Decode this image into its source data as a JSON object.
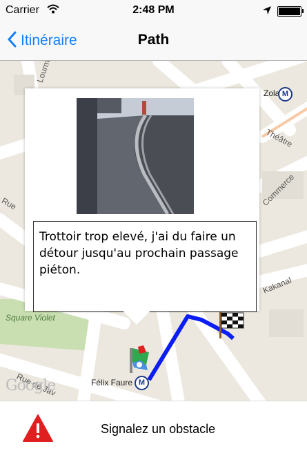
{
  "status": {
    "carrier": "Carrier",
    "time": "2:48 PM"
  },
  "nav": {
    "back_label": "Itinéraire",
    "title": "Path"
  },
  "map": {
    "labels": {
      "lourm": "Lourm",
      "zola": "Zola",
      "rue_left": "Rue",
      "theatre": "Théâtre",
      "commerce": "Commerce",
      "kakanal": "Kakanal",
      "square_violet": "Square Violet",
      "felix_faure": "Félix Faure",
      "rue_jav": "Rue de Jav"
    },
    "metro_symbol": "M",
    "google_logo": "Google",
    "route_color": "#0a1df5"
  },
  "popup": {
    "comment": "Trottoir trop elevé, j'ai du faire un détour jusqu'au prochain passage piéton."
  },
  "bottom": {
    "label": "Signalez un obstacle",
    "warning_color": "#e02020"
  },
  "icons": {
    "back": "chevron-left-icon",
    "wifi": "wifi-icon",
    "location": "location-arrow-icon",
    "battery": "battery-icon",
    "finish": "checkered-flag-icon",
    "start": "start-marker-icon",
    "warning": "warning-triangle-icon"
  }
}
